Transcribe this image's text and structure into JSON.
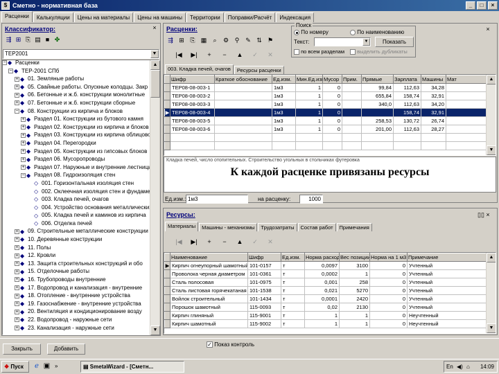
{
  "window": {
    "title": "Сметно - нормативная база",
    "buttons": [
      "_",
      "□",
      "×"
    ]
  },
  "main_tabs": [
    {
      "label": "Расценки",
      "active": true
    },
    {
      "label": "Калькуляции",
      "active": false
    },
    {
      "label": "Цены на материалы",
      "active": false
    },
    {
      "label": "Цены на машины",
      "active": false
    },
    {
      "label": "Территории",
      "active": false
    },
    {
      "label": "Поправки/Расчёт",
      "active": false
    },
    {
      "label": "Индексация",
      "active": false
    }
  ],
  "left": {
    "header": "Классификатор:",
    "header_close": "×",
    "combo_value": "ТЕР2001",
    "tree": [
      {
        "indent": 0,
        "exp": "−",
        "text": "Расценки"
      },
      {
        "indent": 1,
        "exp": "−",
        "text": "ТЕР-2001 СПб"
      },
      {
        "indent": 2,
        "exp": "+",
        "text": "01. Земляные работы"
      },
      {
        "indent": 2,
        "exp": "+",
        "text": "05. Свайные работы. Опускные колодцы. Закр"
      },
      {
        "indent": 2,
        "exp": "+",
        "text": "06. Бетонные и ж.б. конструкции монолитные"
      },
      {
        "indent": 2,
        "exp": "+",
        "text": "07. Бетонные и ж.б. конструкции сборные"
      },
      {
        "indent": 2,
        "exp": "−",
        "text": "08. Конструкции из кирпича и блоков"
      },
      {
        "indent": 3,
        "exp": "+",
        "text": "Раздел 01. Конструкции из бутового камня"
      },
      {
        "indent": 3,
        "exp": "+",
        "text": "Раздел 02. Конструкции из кирпича и блоков"
      },
      {
        "indent": 3,
        "exp": "+",
        "text": "Раздел 03. Конструкции из кирпича облицовочного"
      },
      {
        "indent": 3,
        "exp": "+",
        "text": "Раздел 04. Перегородки"
      },
      {
        "indent": 3,
        "exp": "+",
        "text": "Раздел 05. Конструкции из гипсовых блоков"
      },
      {
        "indent": 3,
        "exp": "+",
        "text": "Раздел 06. Мусоропроводы"
      },
      {
        "indent": 3,
        "exp": "+",
        "text": "Раздел 07. Наружные и внутренние лестницы"
      },
      {
        "indent": 3,
        "exp": "−",
        "text": "Раздел 08. Гидроизоляция стен"
      },
      {
        "indent": 4,
        "exp": "",
        "text": "001. Горизонтальная изоляция стен"
      },
      {
        "indent": 4,
        "exp": "",
        "text": "002. Оклеечная изоляция стен и фундаментов"
      },
      {
        "indent": 4,
        "exp": "",
        "text": "003. Кладка печей, очагов"
      },
      {
        "indent": 4,
        "exp": "",
        "text": "004. Устройство основания металлических"
      },
      {
        "indent": 4,
        "exp": "",
        "text": "005. Кладка печей и каминов из кирпича"
      },
      {
        "indent": 4,
        "exp": "",
        "text": "006. Отделка печей"
      },
      {
        "indent": 2,
        "exp": "+",
        "text": "09. Строительные металлические конструкции"
      },
      {
        "indent": 2,
        "exp": "+",
        "text": "10. Деревянные конструкции"
      },
      {
        "indent": 2,
        "exp": "+",
        "text": "11. Полы"
      },
      {
        "indent": 2,
        "exp": "+",
        "text": "12. Кровли"
      },
      {
        "indent": 2,
        "exp": "+",
        "text": "13. Защита строительных конструкций и обо"
      },
      {
        "indent": 2,
        "exp": "+",
        "text": "15. Отделочные работы"
      },
      {
        "indent": 2,
        "exp": "+",
        "text": "16. Трубопроводы внутренние"
      },
      {
        "indent": 2,
        "exp": "+",
        "text": "17. Водопровод и канализация - внутренние"
      },
      {
        "indent": 2,
        "exp": "+",
        "text": "18. Отопление - внутренние устройства"
      },
      {
        "indent": 2,
        "exp": "+",
        "text": "19. Газоснабжение - внутренние устройства"
      },
      {
        "indent": 2,
        "exp": "+",
        "text": "20. Вентиляция и кондиционирование возду"
      },
      {
        "indent": 2,
        "exp": "+",
        "text": "22. Водопровод - наружные сети"
      },
      {
        "indent": 2,
        "exp": "+",
        "text": "23. Канализация - наружные сети"
      }
    ]
  },
  "rates": {
    "header": "Расценки:",
    "header_close": "×",
    "search": {
      "group_label": "Поиск",
      "by_number": "По номеру",
      "by_name": "По наименованию",
      "text_label": "Текст:",
      "text_value": "",
      "find_button": "Показать",
      "all_sections": "по всем разделам",
      "extra_check": "выделить дубликаты"
    },
    "subtabs": [
      "003. Кладка печей, очагов",
      "Ресурсы расценки"
    ],
    "columns": [
      "Шифр",
      "Краткое обоснование",
      "Ед.изм.",
      "Мин.Ед.изм.",
      "Мусор",
      "Прим.",
      "Прямые",
      "Зарплата",
      "Машины",
      "Мат"
    ],
    "rows": [
      {
        "code": "ТЕР08-08-003-1",
        "short": "",
        "unit": "1м3",
        "min": "1",
        "trash": "0",
        "note": "",
        "direct": "99,84",
        "wage": "112,63",
        "mach": "34,28",
        "mat": ""
      },
      {
        "code": "ТЕР08-08-003-2",
        "short": "",
        "unit": "1м3",
        "min": "1",
        "trash": "0",
        "note": "",
        "direct": "655,84",
        "wage": "158,74",
        "mach": "32,91",
        "mat": ""
      },
      {
        "code": "ТЕР08-08-003-3",
        "short": "",
        "unit": "1м3",
        "min": "1",
        "trash": "0",
        "note": "",
        "direct": "340,0",
        "wage": "112,63",
        "mach": "34,20",
        "mat": ""
      },
      {
        "code": "ТЕР08-08-003-4",
        "short": "",
        "unit": "1м3",
        "min": "1",
        "trash": "0",
        "note": "",
        "direct": "",
        "wage": "158,74",
        "mach": "32,91",
        "mat": "",
        "selected": true
      },
      {
        "code": "ТЕР08-08-003-5",
        "short": "",
        "unit": "1м3",
        "min": "1",
        "trash": "0",
        "note": "",
        "direct": "258,53",
        "wage": "130,72",
        "mach": "26,74",
        "mat": ""
      },
      {
        "code": "ТЕР08-08-003-6",
        "short": "",
        "unit": "1м3",
        "min": "1",
        "trash": "0",
        "note": "",
        "direct": "201,00",
        "wage": "112,63",
        "mach": "28,27",
        "mat": ""
      }
    ],
    "description": "Кладка печей, число отопительных. Строительство угольных в стольчиках футеровка",
    "caption": "К каждой расценке привязаны ресурсы",
    "unit_label": "Ед.изм.:",
    "unit_value": "1м3",
    "per_rate_label": "на расценку:",
    "per_rate_value": "1000"
  },
  "resources": {
    "header": "Ресурсы:",
    "subtabs": [
      "Материалы",
      "Машины - механизмы",
      "Трудозатраты",
      "Состав работ",
      "Примечания"
    ],
    "columns": [
      "Наименование",
      "Шифр",
      "Ед.изм.",
      "Норма расхода",
      "Вес позиции",
      "Норма на 1 м3",
      "Примечание"
    ],
    "rows": [
      {
        "name": "Кирпич огнеупорный шамотный ША-5",
        "code": "101-0157",
        "unit": "т",
        "norm": "0,0097",
        "weight": "3100",
        "n1": "0",
        "note": "Учтенный"
      },
      {
        "name": "Проволока черная диаметром",
        "code": "101-0361",
        "unit": "т",
        "norm": "0,0002",
        "weight": "1",
        "n1": "0",
        "note": "Учтенный"
      },
      {
        "name": "Сталь полосовая",
        "code": "101-0975",
        "unit": "т",
        "norm": "0,001",
        "weight": "258",
        "n1": "0",
        "note": "Учтенный"
      },
      {
        "name": "Сталь листовая горячекатаная",
        "code": "101-1538",
        "unit": "т",
        "norm": "0,021",
        "weight": "5270",
        "n1": "0",
        "note": "Учтенный"
      },
      {
        "name": "Войлок строительный",
        "code": "101-1434",
        "unit": "т",
        "norm": "0,0001",
        "weight": "2420",
        "n1": "0",
        "note": "Учтенный"
      },
      {
        "name": "Порошок шамотный",
        "code": "115-0093",
        "unit": "т",
        "norm": "0,02",
        "weight": "2130",
        "n1": "0",
        "note": "Учтенный"
      },
      {
        "name": "Кирпич глиняный",
        "code": "115-9001",
        "unit": "т",
        "norm": "1",
        "weight": "1",
        "n1": "0",
        "note": "Неучтенный"
      },
      {
        "name": "Кирпич шамотный",
        "code": "115-9002",
        "unit": "т",
        "norm": "1",
        "weight": "1",
        "n1": "0",
        "note": "Неучтенный"
      }
    ]
  },
  "bottom": {
    "close_button": "Закрыть",
    "add_button": "Добавить",
    "check_label": "Показ контроль"
  },
  "taskbar": {
    "start": "Пуск",
    "task": "SmetaWizard - [Сметн...",
    "time": "14:09",
    "lang": "En"
  }
}
